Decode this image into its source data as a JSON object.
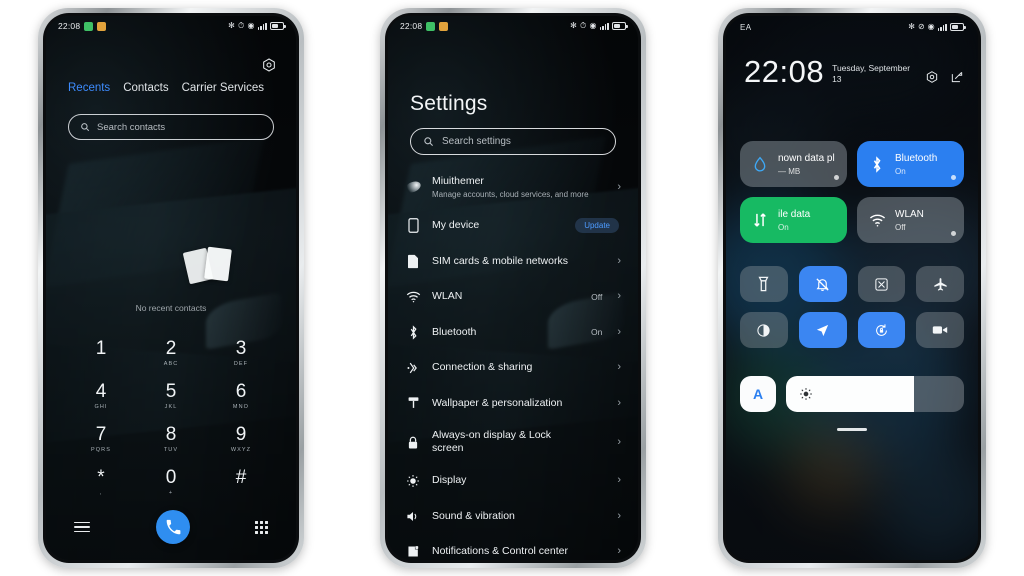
{
  "meta": {
    "background": "#ffffff",
    "accent_blue": "#2f8ef0",
    "accent_green": "#17ba63"
  },
  "phone1": {
    "name": "Dialer / Phone app",
    "statusbar": {
      "time": "22:08",
      "icons": [
        "phone-chip",
        "app-chip",
        "bluetooth",
        "alarm",
        "dnd",
        "vowifi",
        "signal",
        "battery"
      ]
    },
    "tabs": [
      {
        "label": "Recents",
        "active": true
      },
      {
        "label": "Contacts",
        "active": false
      },
      {
        "label": "Carrier Services",
        "active": false
      }
    ],
    "search": {
      "placeholder": "Search contacts"
    },
    "empty_state": "No recent contacts",
    "keys": [
      {
        "digit": "1",
        "letters": ""
      },
      {
        "digit": "2",
        "letters": "ABC"
      },
      {
        "digit": "3",
        "letters": "DEF"
      },
      {
        "digit": "4",
        "letters": "GHI"
      },
      {
        "digit": "5",
        "letters": "JKL"
      },
      {
        "digit": "6",
        "letters": "MNO"
      },
      {
        "digit": "7",
        "letters": "PQRS"
      },
      {
        "digit": "8",
        "letters": "TUV"
      },
      {
        "digit": "9",
        "letters": "WXYZ"
      },
      {
        "digit": "*",
        "letters": ","
      },
      {
        "digit": "0",
        "letters": "+"
      },
      {
        "digit": "#",
        "letters": ""
      }
    ],
    "actions": {
      "menu": "menu-button",
      "call": "call-button",
      "keypad": "keypad-button",
      "settings": "settings-gear"
    }
  },
  "phone2": {
    "name": "Settings app",
    "statusbar": {
      "time": "22:08"
    },
    "title": "Settings",
    "search": {
      "placeholder": "Search settings"
    },
    "items": [
      {
        "icon": "account-icon",
        "title": "Miuithemer",
        "subtitle": "Manage accounts, cloud services, and more",
        "value": "",
        "badge": "",
        "chevron": true
      },
      {
        "icon": "device-icon",
        "title": "My device",
        "subtitle": "",
        "value": "",
        "badge": "Update",
        "chevron": false
      },
      {
        "icon": "sim-icon",
        "title": "SIM cards & mobile networks",
        "subtitle": "",
        "value": "",
        "badge": "",
        "chevron": true
      },
      {
        "icon": "wifi-icon",
        "title": "WLAN",
        "subtitle": "",
        "value": "Off",
        "badge": "",
        "chevron": true
      },
      {
        "icon": "bluetooth-icon",
        "title": "Bluetooth",
        "subtitle": "",
        "value": "On",
        "badge": "",
        "chevron": true
      },
      {
        "icon": "share-icon",
        "title": "Connection & sharing",
        "subtitle": "",
        "value": "",
        "badge": "",
        "chevron": true
      },
      {
        "icon": "wallpaper-icon",
        "title": "Wallpaper & personalization",
        "subtitle": "",
        "value": "",
        "badge": "",
        "chevron": true
      },
      {
        "icon": "lock-icon",
        "title": "Always-on display & Lock screen",
        "subtitle": "",
        "value": "",
        "badge": "",
        "chevron": true
      },
      {
        "icon": "brightness-icon",
        "title": "Display",
        "subtitle": "",
        "value": "",
        "badge": "",
        "chevron": true
      },
      {
        "icon": "sound-icon",
        "title": "Sound & vibration",
        "subtitle": "",
        "value": "",
        "badge": "",
        "chevron": true
      },
      {
        "icon": "notification-icon",
        "title": "Notifications & Control center",
        "subtitle": "",
        "value": "",
        "badge": "",
        "chevron": true
      }
    ]
  },
  "phone3": {
    "name": "Control center",
    "statusbar": {
      "carrier": "EA",
      "icons": [
        "bluetooth",
        "dnd-slash",
        "vowifi",
        "signal",
        "battery"
      ]
    },
    "clock": {
      "time": "22:08",
      "date": "Tuesday, September 13"
    },
    "header_actions": [
      {
        "icon": "settings-gear-icon",
        "name": "control-center-settings"
      },
      {
        "icon": "edit-icon",
        "name": "control-center-edit"
      }
    ],
    "tiles": [
      {
        "title": "nown data pl",
        "subtitle": "— MB",
        "state": "grey",
        "icon": "data-drop-icon"
      },
      {
        "title": "Bluetooth",
        "subtitle": "On",
        "state": "blue",
        "icon": "bluetooth-icon"
      },
      {
        "title": "ile data",
        "subtitle": "On",
        "state": "green",
        "icon": "data-arrows-icon"
      },
      {
        "title": "WLAN",
        "subtitle": "Off",
        "state": "grey",
        "icon": "wifi-icon"
      }
    ],
    "toggles": [
      {
        "name": "flashlight-toggle",
        "icon": "flashlight-icon",
        "on": false
      },
      {
        "name": "silent-toggle",
        "icon": "bell-mute-icon",
        "on": true
      },
      {
        "name": "screenshot-toggle",
        "icon": "screenshot-icon",
        "on": false
      },
      {
        "name": "airplane-toggle",
        "icon": "airplane-icon",
        "on": false
      },
      {
        "name": "dark-mode-toggle",
        "icon": "contrast-icon",
        "on": false
      },
      {
        "name": "location-toggle",
        "icon": "location-arrow-icon",
        "on": true
      },
      {
        "name": "rotation-lock-toggle",
        "icon": "rotation-lock-icon",
        "on": true
      },
      {
        "name": "screen-recorder-toggle",
        "icon": "video-camera-icon",
        "on": false
      }
    ],
    "brightness": {
      "auto_label": "A",
      "value_percent": 72,
      "icon": "sun-icon"
    }
  }
}
